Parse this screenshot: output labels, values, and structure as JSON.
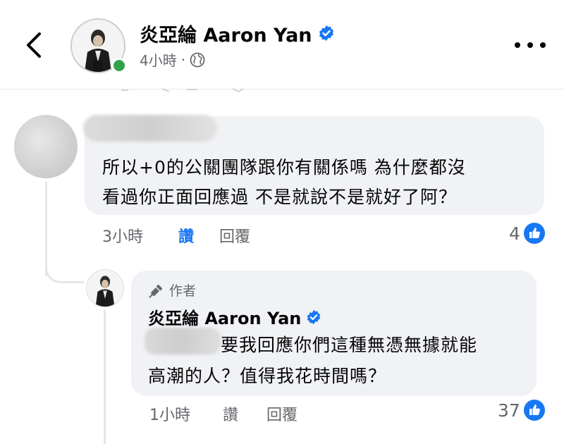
{
  "header": {
    "page_name": "炎亞綸 Aaron Yan",
    "time_ago": "4小時",
    "separator": "·",
    "back_icon": "chevron-left-icon",
    "privacy_icon": "globe-icon",
    "more_icon": "more-horizontal-icon",
    "verified_icon": "verified-badge-icon",
    "online_color": "#31a24c"
  },
  "comment": {
    "text_lines": [
      "所以+0的公關團隊跟你有關係嗎 為什麼都沒",
      "看過你正面回應過 不是就說不是就好了阿？"
    ],
    "time": "3小時",
    "like_label": "讚",
    "reply_label": "回覆",
    "reaction_count": "4",
    "liked": true
  },
  "reply": {
    "author_badge_label": "作者",
    "author_name": "炎亞綸 Aaron Yan",
    "text_lines": [
      "要我回應你們這種無憑無據就能",
      "高潮的人？值得我花時間嗎？"
    ],
    "time": "1小時",
    "like_label": "讚",
    "reply_label": "回覆",
    "reaction_count": "37"
  },
  "colors": {
    "accent": "#1877f2",
    "bubble": "#f0f2f5",
    "secondary_text": "#65676b"
  }
}
